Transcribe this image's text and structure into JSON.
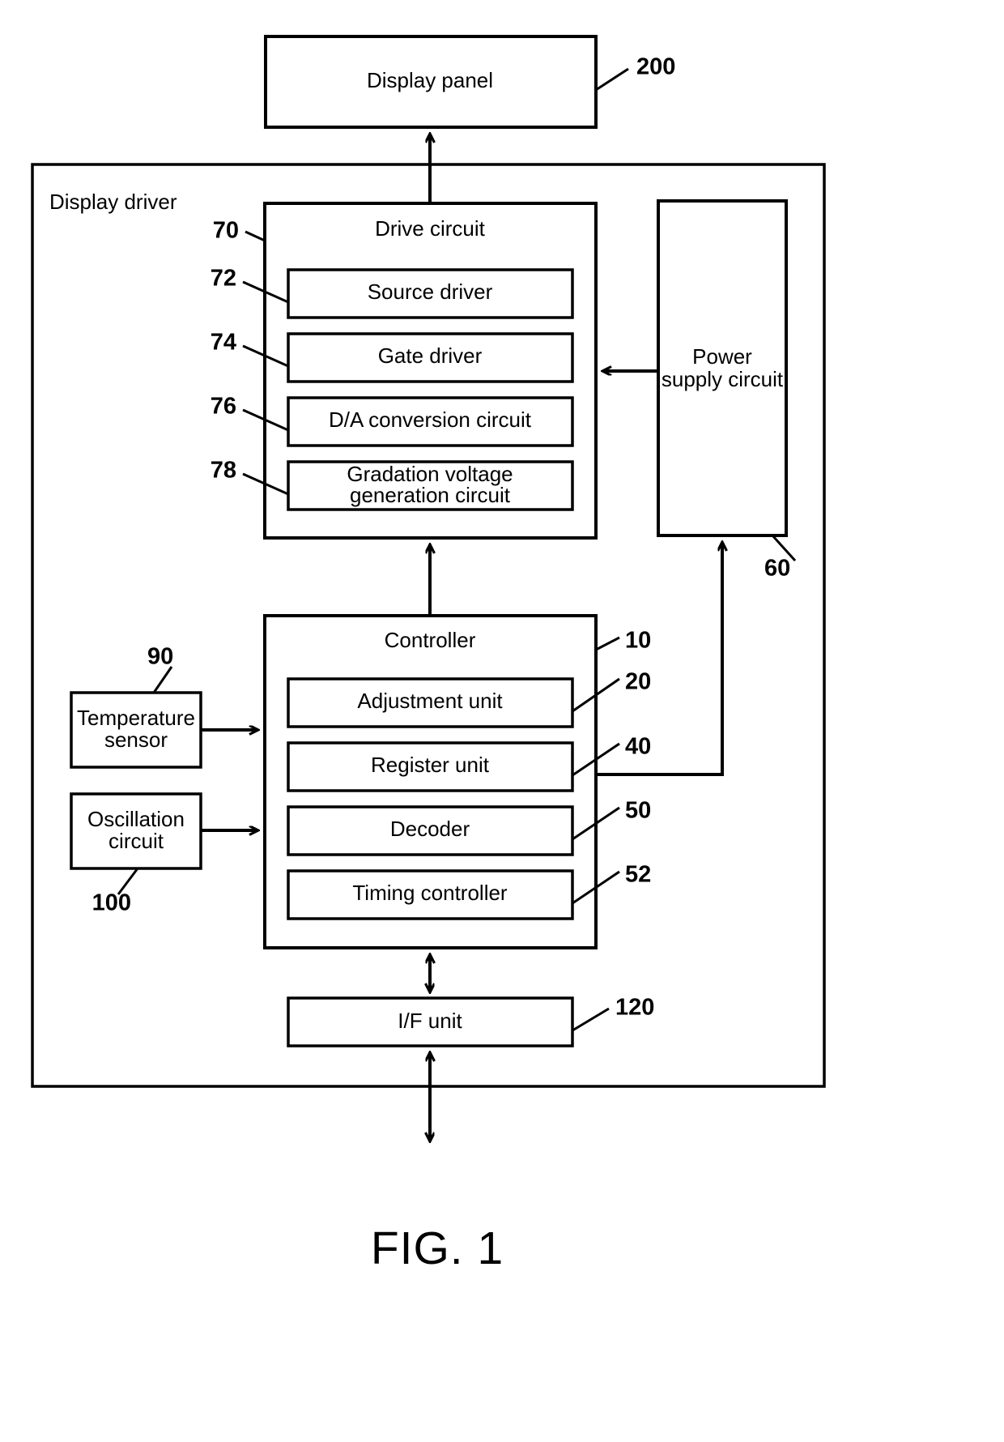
{
  "figure": {
    "caption": "FIG. 1"
  },
  "blocks": {
    "display_panel": {
      "label": "Display panel",
      "ref": "200"
    },
    "display_driver": {
      "label": "Display driver"
    },
    "drive_circuit": {
      "label": "Drive circuit",
      "ref": "70"
    },
    "source_driver": {
      "label": "Source driver",
      "ref": "72"
    },
    "gate_driver": {
      "label": "Gate driver",
      "ref": "74"
    },
    "da_conversion_circuit": {
      "label": "D/A conversion circuit",
      "ref": "76"
    },
    "gradation_voltage_generation_circuit": {
      "label_line1": "Gradation voltage",
      "label_line2": "generation circuit",
      "ref": "78"
    },
    "power_supply_circuit": {
      "label_line1": "Power",
      "label_line2": "supply circuit",
      "ref": "60"
    },
    "controller": {
      "label": "Controller",
      "ref": "10"
    },
    "adjustment_unit": {
      "label": "Adjustment unit",
      "ref": "20"
    },
    "register_unit": {
      "label": "Register unit",
      "ref": "40"
    },
    "decoder": {
      "label": "Decoder",
      "ref": "50"
    },
    "timing_controller": {
      "label": "Timing controller",
      "ref": "52"
    },
    "temperature_sensor": {
      "label_line1": "Temperature",
      "label_line2": "sensor",
      "ref": "90"
    },
    "oscillation_circuit": {
      "label_line1": "Oscillation",
      "label_line2": "circuit",
      "ref": "100"
    },
    "if_unit": {
      "label": "I/F unit",
      "ref": "120"
    }
  },
  "colors": {
    "stroke": "#000000",
    "fill": "#ffffff"
  }
}
